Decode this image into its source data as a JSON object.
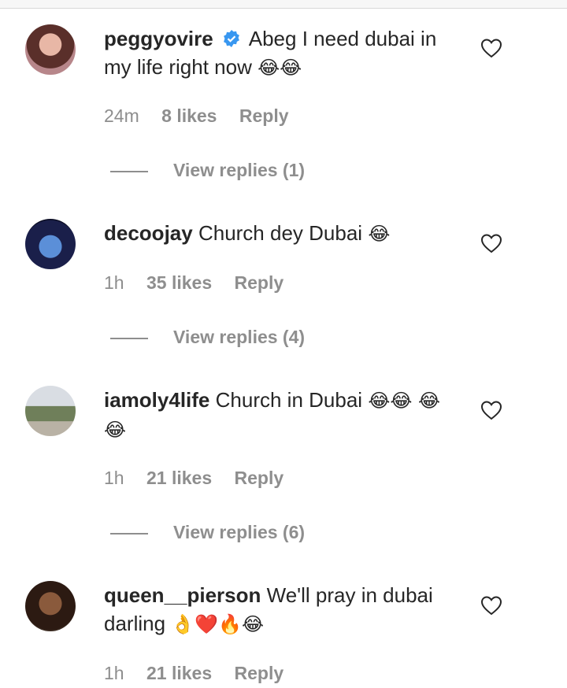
{
  "comments": [
    {
      "username": "peggyovire",
      "verified": true,
      "text": "Abeg I need dubai in my life right now",
      "emojis": "😂😂",
      "time": "24m",
      "likes": "8 likes",
      "reply": "Reply",
      "view_replies": "View replies (1)"
    },
    {
      "username": "decoojay",
      "verified": false,
      "text": "Church dey Dubai",
      "emojis": "😂",
      "time": "1h",
      "likes": "35 likes",
      "reply": "Reply",
      "view_replies": "View replies (4)"
    },
    {
      "username": "iamoly4life",
      "verified": false,
      "text": "Church in Dubai",
      "emojis": "😂😂 😂😂",
      "time": "1h",
      "likes": "21 likes",
      "reply": "Reply",
      "view_replies": "View replies (6)"
    },
    {
      "username": "queen__pierson",
      "verified": false,
      "text": "We'll pray in dubai darling",
      "emojis": "👌❤️🔥😂",
      "time": "1h",
      "likes": "21 likes",
      "reply": "Reply"
    }
  ],
  "icons": {
    "like": "heart-outline-icon",
    "verified": "verified-badge-icon"
  },
  "colors": {
    "verified": "#3897f0",
    "muted": "#8e8e8e",
    "text": "#262626"
  }
}
